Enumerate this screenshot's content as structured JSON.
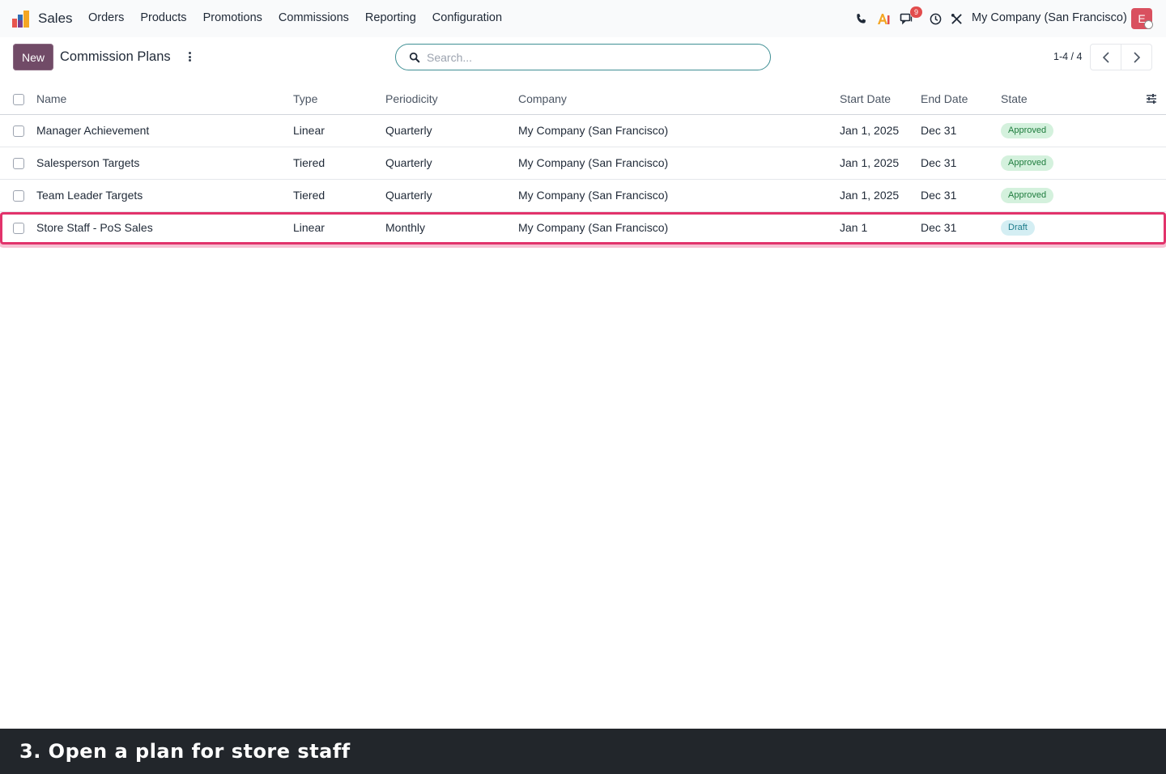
{
  "app": {
    "name": "Sales",
    "menu": [
      "Orders",
      "Products",
      "Promotions",
      "Commissions",
      "Reporting",
      "Configuration"
    ]
  },
  "systray": {
    "messages_badge": "9",
    "company": "My Company (San Francisco)",
    "avatar_initial": "E"
  },
  "control_panel": {
    "new_label": "New",
    "title": "Commission Plans",
    "search_placeholder": "Search...",
    "pager": "1-4 / 4"
  },
  "table": {
    "columns": [
      "Name",
      "Type",
      "Periodicity",
      "Company",
      "Start Date",
      "End Date",
      "State"
    ],
    "rows": [
      {
        "name": "Manager Achievement",
        "type": "Linear",
        "periodicity": "Quarterly",
        "company": "My Company (San Francisco)",
        "start": "Jan 1, 2025",
        "end": "Dec 31",
        "state": "Approved"
      },
      {
        "name": "Salesperson Targets",
        "type": "Tiered",
        "periodicity": "Quarterly",
        "company": "My Company (San Francisco)",
        "start": "Jan 1, 2025",
        "end": "Dec 31",
        "state": "Approved"
      },
      {
        "name": "Team Leader Targets",
        "type": "Tiered",
        "periodicity": "Quarterly",
        "company": "My Company (San Francisco)",
        "start": "Jan 1, 2025",
        "end": "Dec 31",
        "state": "Approved"
      },
      {
        "name": "Store Staff - PoS Sales",
        "type": "Linear",
        "periodicity": "Monthly",
        "company": "My Company (San Francisco)",
        "start": "Jan 1",
        "end": "Dec 31",
        "state": "Draft"
      }
    ]
  },
  "caption": "3. Open a plan for store staff",
  "colors": {
    "brand": "#714b67",
    "highlight": "#e2336b",
    "approved_bg": "#d4f1dd",
    "draft_bg": "#d4eef3"
  },
  "icons": [
    "app-logo-icon",
    "phone-icon",
    "ai-icon",
    "chat-icon",
    "clock-icon",
    "tools-icon",
    "search-icon",
    "chevron-left-icon",
    "chevron-right-icon",
    "column-settings-icon"
  ]
}
